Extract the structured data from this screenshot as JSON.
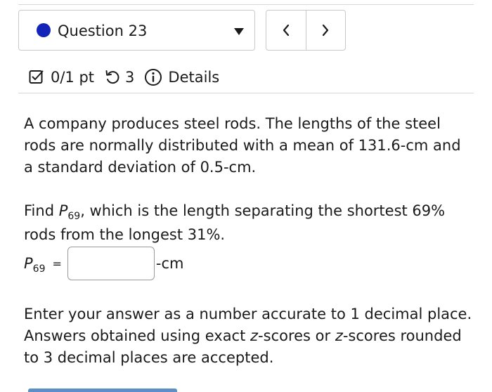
{
  "header": {
    "question_label": "Question 23",
    "status_color": "#1424b8",
    "dropdown_icon": "caret-down-icon",
    "nav": {
      "prev_icon": "chevron-left-icon",
      "next_icon": "chevron-right-icon"
    }
  },
  "meta": {
    "score_icon": "checkbox-edit-icon",
    "score": "0/1 pt",
    "retry_icon": "retry-icon",
    "attempts": "3",
    "info_icon": "info-icon",
    "details_label": "Details"
  },
  "problem": {
    "intro": "A company produces steel rods. The lengths of the steel rods are normally distributed with a mean of 131.6-cm and a standard deviation of 0.5-cm.",
    "find_prefix": "Find ",
    "find_var": "P",
    "find_sub": "69",
    "find_suffix": ", which is the length separating the shortest 69% rods from the longest 31%.",
    "answer_var": "P",
    "answer_sub": "69",
    "answer_equals": "=",
    "answer_value": "",
    "answer_unit": "-cm",
    "instructions_1": "Enter your answer as a number accurate to 1 decimal place. Answers obtained using exact ",
    "instructions_z1": "z",
    "instructions_2": "-scores or ",
    "instructions_z2": "z",
    "instructions_3": "-scores rounded to 3 decimal places are accepted."
  },
  "colors": {
    "accent": "#1424b8",
    "border": "#c9c9c9",
    "bottom_bar": "#5b8fc6"
  }
}
